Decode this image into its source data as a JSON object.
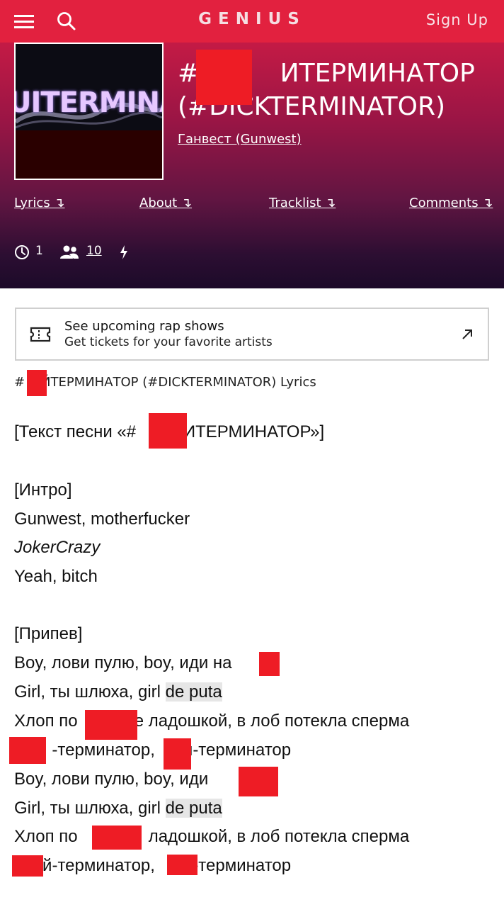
{
  "header": {
    "logo": "GENIUS",
    "signup_label": "Sign Up"
  },
  "song": {
    "title_line1": "#     ИТЕРМИНАТОР",
    "title_line2": "(#DICKTERMINATOR)",
    "cover_text": "UITERMINAT",
    "artist": "Ганвест (Gunwest)"
  },
  "nav": {
    "lyrics": "Lyrics ↴",
    "about": "About ↴",
    "tracklist": "Tracklist ↴",
    "comments": "Comments ↴"
  },
  "stats": {
    "clock_count": "1",
    "contributors_count": "10"
  },
  "banner": {
    "title": "See upcoming rap shows",
    "subtitle": "Get tickets for your favorite artists"
  },
  "lyrics_heading": "#  ЙТЕРМИНАТОР (#DICKTERMINATOR) Lyrics",
  "lyrics": {
    "l1": "[Текст песни «#     ИТЕРМИНАТОР»]",
    "l2": "[Интро]",
    "l3": "Gunwest, motherfucker",
    "l4": "JokerCrazy",
    "l5": "Yeah, bitch",
    "l6": "[Припев]",
    "l7": "Boy, лови пулю, boy, иди на   й",
    "l8a": "Girl, ты шлюха, girl ",
    "l8b": "de puta",
    "l9": "Хлоп по      е ладошкой, в лоб потекла сперма",
    "l10": "    -терминатор,   й-терминатор",
    "l11": "Boy, лови пулю, boy, иди      й",
    "l12a": "Girl, ты шлюха, girl ",
    "l12b": "de puta",
    "l13": "Хлоп по        ладошкой, в лоб потекла сперма",
    "l14": "   й-терминатор,    -терминатор"
  }
}
